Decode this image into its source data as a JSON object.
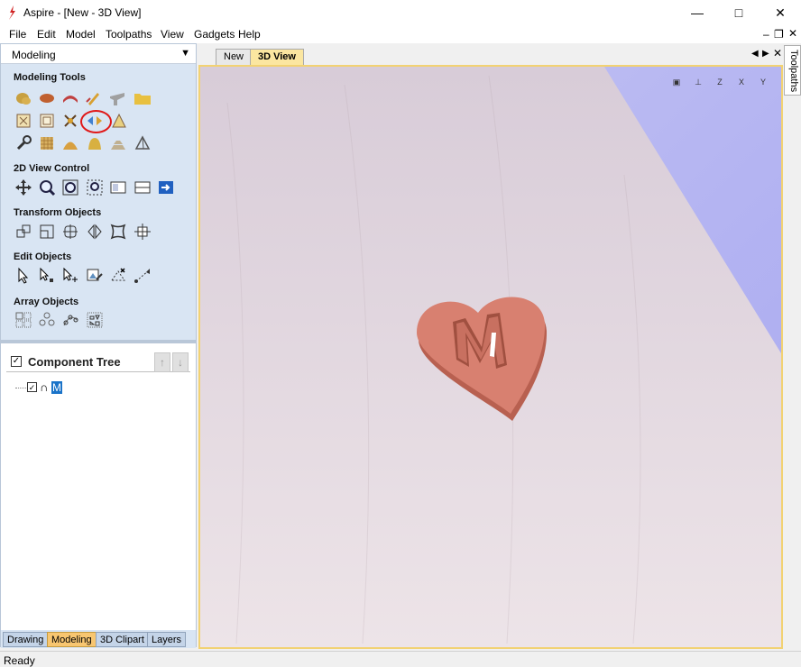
{
  "window": {
    "title": "Aspire - [New - 3D View]"
  },
  "menu": [
    "File",
    "Edit",
    "Model",
    "Toolpaths",
    "View",
    "Gadgets",
    "Help"
  ],
  "left_panel": {
    "title": "Modeling",
    "sections": {
      "modeling_tools": "Modeling Tools",
      "view_control": "2D View Control",
      "transform": "Transform Objects",
      "edit": "Edit Objects",
      "array": "Array Objects"
    },
    "component_tree": {
      "title": "Component Tree",
      "item_label": "M"
    },
    "tabs": [
      "Drawing",
      "Modeling",
      "3D Clipart",
      "Layers"
    ],
    "active_tab": "Modeling"
  },
  "doc_tabs": [
    "New",
    "3D View"
  ],
  "active_doc_tab": "3D View",
  "right_tab": "Toolpaths",
  "view_toolbar": [
    "fit-view",
    "iso",
    "Z",
    "X",
    "Y"
  ],
  "status": "Ready",
  "colors": {
    "panel_bg": "#d9e5f3",
    "active_tab": "#f8c670",
    "model_color": "#d88070",
    "highlight_circle": "#e01818"
  }
}
